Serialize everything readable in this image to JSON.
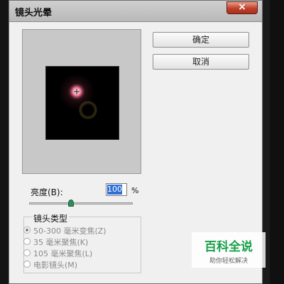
{
  "dialog": {
    "title": "镜头光晕",
    "close_symbol": "×",
    "buttons": {
      "ok": "确定",
      "cancel": "取消"
    },
    "brightness": {
      "label": "亮度(B):",
      "value": "100",
      "unit": "%",
      "slider_fraction": 0.4
    },
    "lens_type": {
      "title": "镜头类型",
      "options": [
        {
          "label": "50-300 毫米变焦(Z)",
          "selected": true
        },
        {
          "label": "35 毫米聚焦(K)",
          "selected": false
        },
        {
          "label": "105 毫米聚焦(L)",
          "selected": false
        },
        {
          "label": "电影镜头(M)",
          "selected": false
        }
      ]
    },
    "preview": {
      "crosshair": "+"
    }
  },
  "watermark": {
    "main": "百科全说",
    "sub": "助你轻松解决"
  },
  "colors": {
    "accent": "#2f6fd6",
    "close": "#c0402a",
    "watermark_green": "#18a04a"
  }
}
